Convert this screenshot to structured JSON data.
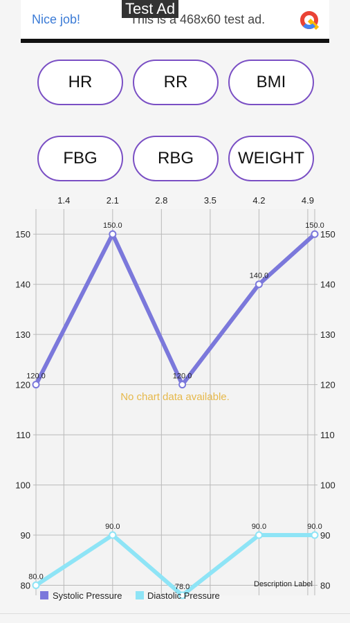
{
  "ad": {
    "badge": "Test Ad",
    "left_text": "Nice job!",
    "text": "This is a 468x60 test ad.",
    "logo_icon": "ad-logo-icon"
  },
  "buttons": {
    "hr": "HR",
    "rr": "RR",
    "bmi": "BMI",
    "fbg": "FBG",
    "rbg": "RBG",
    "weight": "WEIGHT"
  },
  "chart_data": {
    "type": "line",
    "x": [
      1.0,
      2.1,
      3.1,
      4.2,
      5.0
    ],
    "x_tick_labels": [
      "1.4",
      "2.1",
      "2.8",
      "3.5",
      "4.2",
      "4.9"
    ],
    "y_tick_labels": [
      "80",
      "90",
      "100",
      "110",
      "120",
      "130",
      "140",
      "150"
    ],
    "ylim": [
      78,
      155
    ],
    "series": [
      {
        "name": "Systolic Pressure",
        "values": [
          120.0,
          150.0,
          120.0,
          140.0,
          150.0
        ],
        "labels": [
          "120.0",
          "150.0",
          "120.0",
          "140.0",
          "150.0"
        ],
        "color": "#7b78db"
      },
      {
        "name": "Diastolic Pressure",
        "values": [
          80.0,
          90.0,
          78.0,
          90.0,
          90.0
        ],
        "labels": [
          "80.0",
          "90.0",
          "78.0",
          "90.0",
          "90.0"
        ],
        "color": "#8ee4f6"
      }
    ],
    "no_data_text": "No chart data available.",
    "description": "Description Label",
    "grid": true,
    "legend_position": "bottom-left"
  }
}
